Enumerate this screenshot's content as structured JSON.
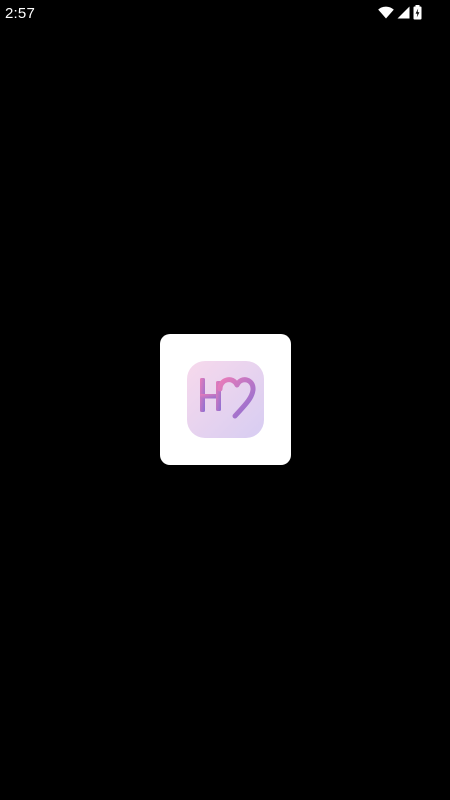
{
  "status_bar": {
    "time": "2:57",
    "icons": [
      "wifi-icon",
      "cell-signal-icon",
      "battery-charging-icon"
    ],
    "icon_color": "#ffffff"
  },
  "splash": {
    "background_color": "#000000",
    "card_color": "#ffffff",
    "logo": {
      "icon": "heart-h-logo-icon",
      "gradient_from": "#f7d9ec",
      "gradient_to": "#d7cdf2",
      "glyph_color_from": "#e97cb9",
      "glyph_color_to": "#8b6fd3"
    }
  }
}
